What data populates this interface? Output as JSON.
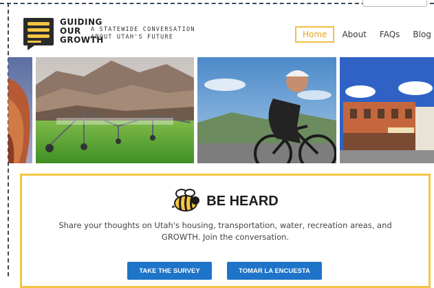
{
  "brand": {
    "logo_lines": [
      "GUIDING",
      "OUR",
      "GROWTH"
    ],
    "tagline_lines": [
      "A STATEWIDE CONVERSATION",
      "ABOUT UTAH'S FUTURE"
    ],
    "logo_icon": "speech-bubble-logo-icon",
    "colors": {
      "gold": "#f4c542",
      "dark": "#2a2a2a"
    }
  },
  "nav": {
    "items": [
      {
        "label": "Home",
        "active": true
      },
      {
        "label": "About",
        "active": false
      },
      {
        "label": "FAQs",
        "active": false
      },
      {
        "label": "Blog",
        "active": false
      }
    ],
    "active_color": "#e9a21c"
  },
  "gallery": {
    "photos": [
      "red-rock-cliffs-photo",
      "irrigation-field-photo",
      "cyclist-photo",
      "small-town-street-photo"
    ]
  },
  "cta": {
    "icon": "bee-icon",
    "title": "BE HEARD",
    "body": "Share your thoughts on Utah's housing, transportation, water, recreation areas, and GROWTH. Join the conversation.",
    "buttons": [
      {
        "label": "TAKE THE SURVEY"
      },
      {
        "label": "TOMAR LA ENCUESTA"
      }
    ],
    "border_color": "#f4c542",
    "button_color": "#1e74c8"
  }
}
